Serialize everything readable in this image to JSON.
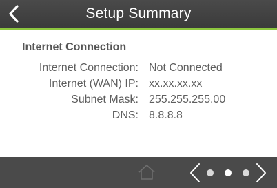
{
  "header": {
    "title": "Setup Summary",
    "back_icon": "chevron-left-icon"
  },
  "colors": {
    "header_bg": "#3f3f3f",
    "accent": "#8dc63f",
    "footer_bg": "#4a4a4a"
  },
  "section": {
    "title": "Internet Connection"
  },
  "rows": [
    {
      "label": "Internet Connection:",
      "value": "Not Connected"
    },
    {
      "label": "Internet (WAN) IP:",
      "value": "xx.xx.xx.xx"
    },
    {
      "label": "Subnet Mask:",
      "value": "255.255.255.00"
    },
    {
      "label": "DNS:",
      "value": "8.8.8.8"
    }
  ],
  "footer": {
    "home_icon": "home-icon",
    "prev_icon": "chevron-left-icon",
    "next_icon": "chevron-right-icon",
    "pages_total": 3,
    "pages_current": 2
  }
}
